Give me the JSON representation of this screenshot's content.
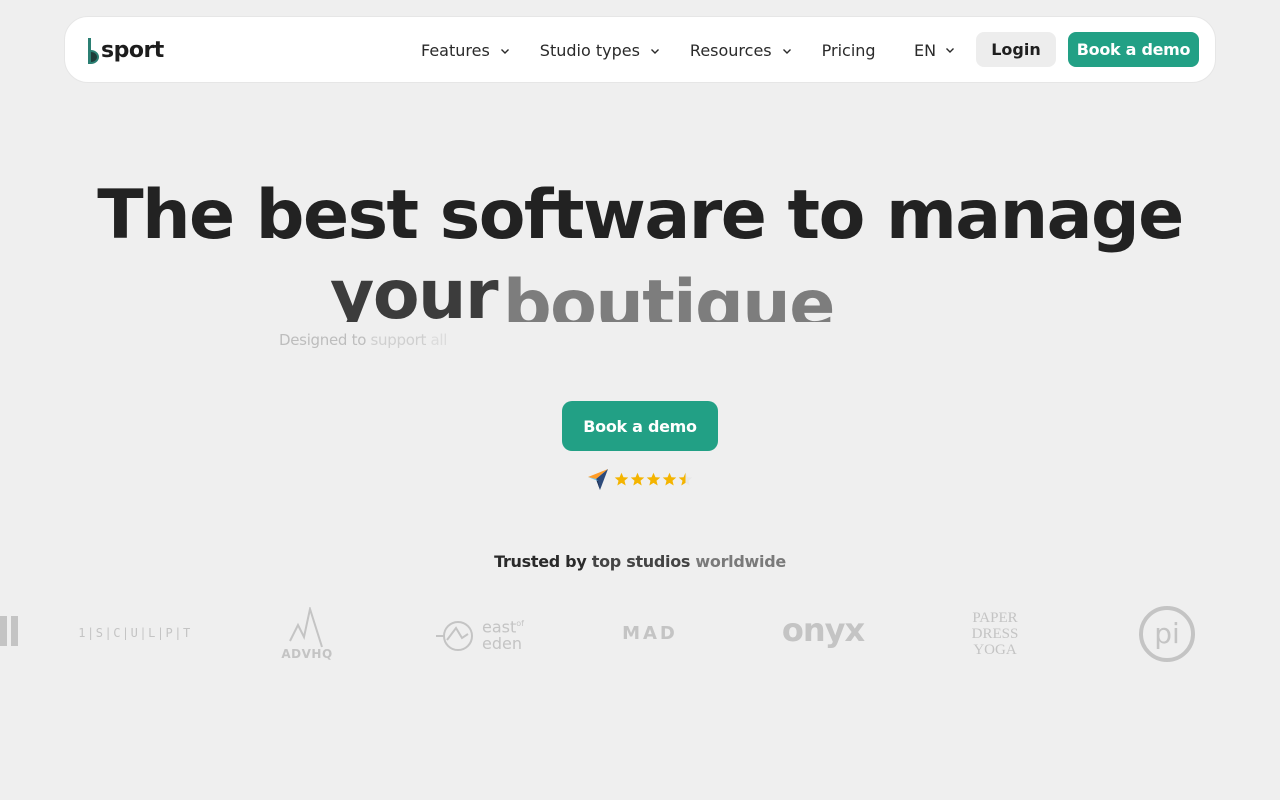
{
  "brand": {
    "name": "sport",
    "accent": "#22a085"
  },
  "nav": {
    "items": [
      {
        "label": "Features",
        "has_dropdown": true
      },
      {
        "label": "Studio types",
        "has_dropdown": true
      },
      {
        "label": "Resources",
        "has_dropdown": true
      },
      {
        "label": "Pricing",
        "has_dropdown": false
      }
    ],
    "language": "EN",
    "login_label": "Login",
    "demo_label": "Book a demo"
  },
  "hero": {
    "line1": "The best software to manage",
    "line2_static": "your",
    "line2_rotating": "boutique",
    "subtext_1": "Designed to",
    "subtext_2": "support",
    "subtext_3": "all",
    "cta_label": "Book a demo",
    "rating_icon": "capterra-icon",
    "rating_stars": 4.5
  },
  "trusted": {
    "part1": "Trusted by",
    "part2": "top studios",
    "part3": "worldwide"
  },
  "logos": {
    "sculpt": "1|S|C|U|L|P|T",
    "advhq": "ADVHQ",
    "eastofeden_1": "east",
    "eastofeden_of": "of",
    "eastofeden_2": "eden",
    "mad": "MAD",
    "onyx": "onyx",
    "paper_1": "PAPER",
    "paper_2": "DRESS",
    "paper_3": "YOGA",
    "pi": "pi"
  }
}
